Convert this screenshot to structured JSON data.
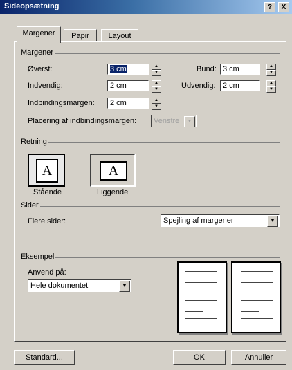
{
  "dialog": {
    "title": "Sideopsætning",
    "help_glyph": "?",
    "close_glyph": "X"
  },
  "tabs": [
    {
      "label": "Margener"
    },
    {
      "label": "Papir"
    },
    {
      "label": "Layout"
    }
  ],
  "margins": {
    "group_label": "Margener",
    "top": {
      "label": "Øverst:",
      "value": "3 cm"
    },
    "bottom": {
      "label": "Bund:",
      "value": "3 cm"
    },
    "inside": {
      "label": "Indvendig:",
      "value": "2 cm"
    },
    "outside": {
      "label": "Udvendig:",
      "value": "2 cm"
    },
    "gutter": {
      "label": "Indbindingsmargen:",
      "value": "2 cm"
    },
    "gutter_position": {
      "label": "Placering af indbindingsmargen:",
      "value": "Venstre"
    }
  },
  "orientation": {
    "group_label": "Retning",
    "portrait": {
      "label": "Stående",
      "glyph": "A"
    },
    "landscape": {
      "label": "Liggende",
      "glyph": "A"
    }
  },
  "pages": {
    "group_label": "Sider",
    "multiple_label": "Flere sider:",
    "multiple_value": "Spejling af margener"
  },
  "preview": {
    "group_label": "Eksempel",
    "apply_label": "Anvend på:",
    "apply_value": "Hele dokumentet"
  },
  "buttons": {
    "default": "Standard...",
    "ok": "OK",
    "cancel": "Annuller"
  },
  "spin_glyphs": {
    "up": "▲",
    "down": "▼"
  }
}
